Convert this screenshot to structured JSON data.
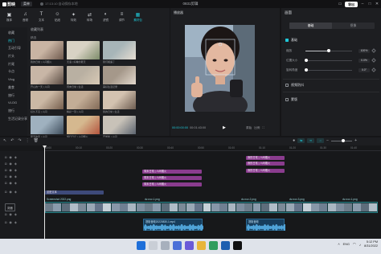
{
  "app": {
    "logo_text": "剪映",
    "menu_label": "菜单",
    "autosave_text": "17:13:10 自动保存本地",
    "window_title": "0831剪辑",
    "export_label": "导出"
  },
  "tool_tabs": [
    {
      "label": "媒体",
      "icon": "media-icon",
      "active": false
    },
    {
      "label": "音频",
      "icon": "audio-icon",
      "active": false
    },
    {
      "label": "文本",
      "icon": "text-icon",
      "active": false
    },
    {
      "label": "贴纸",
      "icon": "sticker-icon",
      "active": false
    },
    {
      "label": "特效",
      "icon": "effects-icon",
      "active": false
    },
    {
      "label": "转场",
      "icon": "transition-icon",
      "active": false
    },
    {
      "label": "滤镜",
      "icon": "filter-icon",
      "active": false
    },
    {
      "label": "调节",
      "icon": "adjust-icon",
      "active": false
    },
    {
      "label": "素材包",
      "icon": "package-icon",
      "active": true
    }
  ],
  "sidebar": {
    "items": [
      "收藏",
      "热门",
      "互动引导",
      "片头",
      "片尾",
      "卡点",
      "Vlog",
      "美食",
      "旅行",
      "VLOG",
      "旅行",
      "生活记录分享"
    ]
  },
  "media": {
    "breadcrumb": "收藏列表",
    "section": "精选",
    "thumbs": [
      {
        "caption": "我的日常 | 人间烟火",
        "colors": [
          "#c9b4a3",
          "#6f5a4e"
        ]
      },
      {
        "caption": "无语 | 好看的夏天",
        "colors": [
          "#d8d2c4",
          "#7d8c6a"
        ]
      },
      {
        "caption": "我们相遇了",
        "colors": [
          "#a7b5b8",
          "#e6ddd2"
        ]
      },
      {
        "caption": "开心的一天 | 人间",
        "colors": [
          "#c8b6a6",
          "#5a4b43"
        ]
      },
      {
        "caption": "周末日常 | 生活",
        "colors": [
          "#b9b0a2",
          "#d7c9b5"
        ]
      },
      {
        "caption": "美好生活记录",
        "colors": [
          "#a5988a",
          "#e2d8cc"
        ]
      },
      {
        "caption": "好久不见 | 人间",
        "colors": [
          "#cbb8a4",
          "#755e4d"
        ]
      },
      {
        "caption": "精彩一刻 | 人间",
        "colors": [
          "#c3ad96",
          "#826a57"
        ]
      },
      {
        "caption": "我的日常 | 生活",
        "colors": [
          "#d3c2b0",
          "#6d5c50"
        ]
      },
      {
        "caption": "夏天的风 | 人间",
        "colors": [
          "#9fb1bf",
          "#3e4d5c"
        ]
      },
      {
        "caption": "旅行日记 | 人间烟火",
        "colors": [
          "#d5b88f",
          "#b4553e"
        ]
      },
      {
        "caption": "开学啦 | 人间",
        "colors": [
          "#c8c2b8",
          "#5c6470"
        ]
      }
    ]
  },
  "player": {
    "title": "播放器",
    "current_time": "00:00:00:00",
    "duration": "00:01:43:00",
    "tool_labels": [
      "原始",
      "比例"
    ]
  },
  "inspector": {
    "title": "画面",
    "tabs": [
      "基础",
      "抠像"
    ],
    "mix_label": "基础",
    "sliders": [
      {
        "label": "缩放",
        "value": "100%",
        "level": 0.5
      },
      {
        "label": "位置大小",
        "value": "0.0%",
        "level": 0.0
      },
      {
        "label": "旋转角度",
        "value": "0.0°",
        "level": 0.0
      }
    ],
    "stabilize_label": "视频防抖",
    "matting_label": "蒙版"
  },
  "timeline": {
    "ruler_marks": [
      "00:00",
      "00:10",
      "00:20",
      "00:30",
      "00:40",
      "00:50",
      "01:00",
      "01:10",
      "01:20",
      "01:30",
      "01:40"
    ],
    "cover_label": "封面",
    "clips_row1": [
      {
        "label": "我的日常 | 人间烟火",
        "kind": "pink"
      }
    ],
    "clips_row2": [
      {
        "label": "周末日常 | 人间烟火",
        "kind": "pink"
      },
      {
        "label": "周末日常 | 人间烟火",
        "kind": "pink"
      }
    ],
    "text_clip": "这是文本",
    "video_clip_labels": [
      "Screenshot 2022.png",
      "dv-nov-1.png",
      "dv-nov-2.png",
      "dv-nov-3.png",
      "dv-nov-1.png"
    ],
    "audio_clip_labels": [
      "提取音频20220830-1.mp4",
      "提取音频"
    ]
  },
  "taskbar": {
    "time": "5:12 PM",
    "date": "8/31/2022",
    "lang": "ENG"
  }
}
